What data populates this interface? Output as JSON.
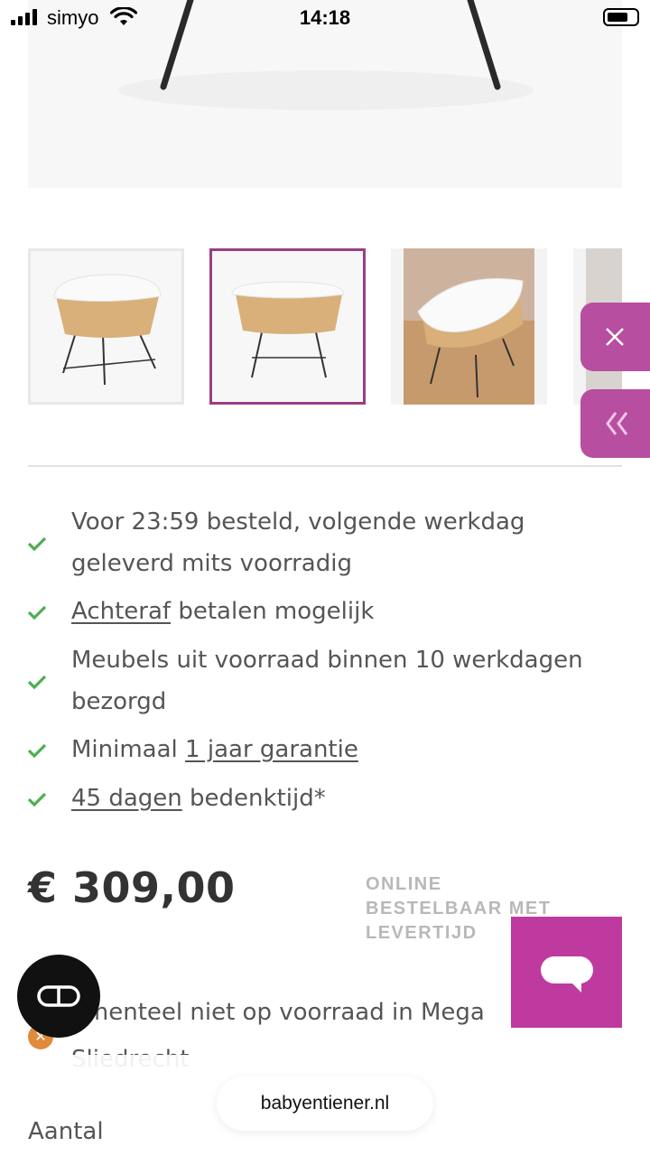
{
  "status_bar": {
    "carrier": "simyo",
    "time": "14:18"
  },
  "gallery": {
    "thumbnails": [
      {
        "label": "thumbnail-1",
        "selected": false
      },
      {
        "label": "thumbnail-2",
        "selected": true
      },
      {
        "label": "thumbnail-3",
        "selected": false
      },
      {
        "label": "thumbnail-4",
        "selected": false
      }
    ]
  },
  "side_buttons": {
    "close_icon": "close-icon",
    "expand_icon": "double-chevron-left-icon",
    "close_glyph": "✕",
    "expand_glyph": "«"
  },
  "usps": [
    {
      "line": "Voor 23:59 besteld, volgende werkdag geleverd mits voorradig"
    },
    {
      "link": "Achteraf",
      "rest": " betalen mogelijk"
    },
    {
      "line": "Meubels uit voorraad binnen 10 werkdagen bezorgd"
    },
    {
      "prefix": "Minimaal ",
      "link": "1 jaar garantie"
    },
    {
      "link": "45 dagen",
      "rest": " bedenktijd*"
    }
  ],
  "price": {
    "amount": "€ 309,00",
    "availability": "ONLINE BESTELBAAR MET LEVERTIJD"
  },
  "stock": {
    "text": "Momenteel niet op voorraad in Mega Sliedrecht",
    "visible_text": "omenteel niet op voorraad in Mega",
    "line2": "Sliedrecht"
  },
  "browser": {
    "url": "babyentiener.nl"
  },
  "quantity": {
    "label": "Aantal"
  },
  "colors": {
    "accent": "#b84e9f",
    "chat": "#bf3a9f",
    "check": "#4caf50",
    "selected_border": "#9b3d87"
  }
}
